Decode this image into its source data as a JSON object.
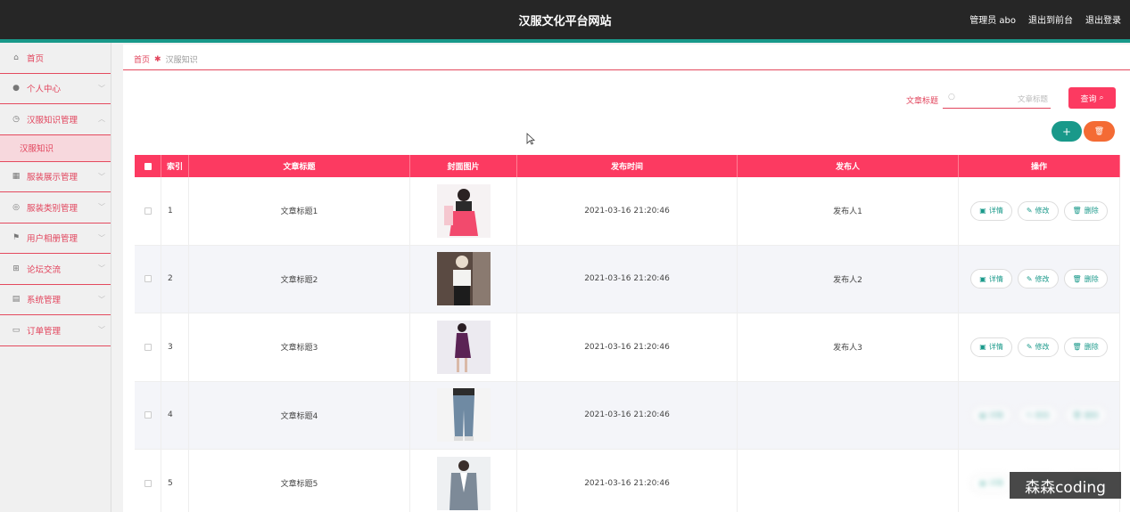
{
  "header": {
    "site_title": "汉服文化平台网站",
    "user_label": "管理员 abo",
    "back_to_front": "退出到前台",
    "logout": "退出登录"
  },
  "sidebar": {
    "items": [
      {
        "label": "首页",
        "icon": "home-icon",
        "expandable": false
      },
      {
        "label": "个人中心",
        "icon": "user-icon",
        "expandable": true
      },
      {
        "label": "汉服知识管理",
        "icon": "clock-icon",
        "expandable": true,
        "expanded": true,
        "children": [
          {
            "label": "汉服知识"
          }
        ]
      },
      {
        "label": "服装展示管理",
        "icon": "image-icon",
        "expandable": true
      },
      {
        "label": "服装类别管理",
        "icon": "compass-icon",
        "expandable": true
      },
      {
        "label": "用户相册管理",
        "icon": "flag-icon",
        "expandable": true
      },
      {
        "label": "论坛交流",
        "icon": "grid-icon",
        "expandable": true
      },
      {
        "label": "系统管理",
        "icon": "clipboard-icon",
        "expandable": true
      },
      {
        "label": "订单管理",
        "icon": "card-icon",
        "expandable": true
      }
    ]
  },
  "breadcrumb": {
    "home": "首页",
    "current": "汉服知识"
  },
  "search": {
    "label": "文章标题",
    "placeholder": "文章标题",
    "button": "查询"
  },
  "toolbar": {
    "add_label": "+",
    "delete_icon": "trash-icon"
  },
  "table": {
    "columns": [
      "索引",
      "文章标题",
      "封面图片",
      "发布时间",
      "发布人",
      "操作"
    ],
    "actions": {
      "detail": "详情",
      "edit": "修改",
      "remove": "删除"
    },
    "rows": [
      {
        "index": "1",
        "title": "文章标题1",
        "time": "2021-03-16 21:20:46",
        "publisher": "发布人1"
      },
      {
        "index": "2",
        "title": "文章标题2",
        "time": "2021-03-16 21:20:46",
        "publisher": "发布人2"
      },
      {
        "index": "3",
        "title": "文章标题3",
        "time": "2021-03-16 21:20:46",
        "publisher": "发布人3"
      },
      {
        "index": "4",
        "title": "文章标题4",
        "time": "2021-03-16 21:20:46",
        "publisher": ""
      },
      {
        "index": "5",
        "title": "文章标题5",
        "time": "2021-03-16 21:20:46",
        "publisher": ""
      }
    ]
  },
  "watermark": "森森coding",
  "colors": {
    "primary": "#fc3a61",
    "accent": "#19998a",
    "danger": "#f46b34",
    "header": "#262626"
  }
}
